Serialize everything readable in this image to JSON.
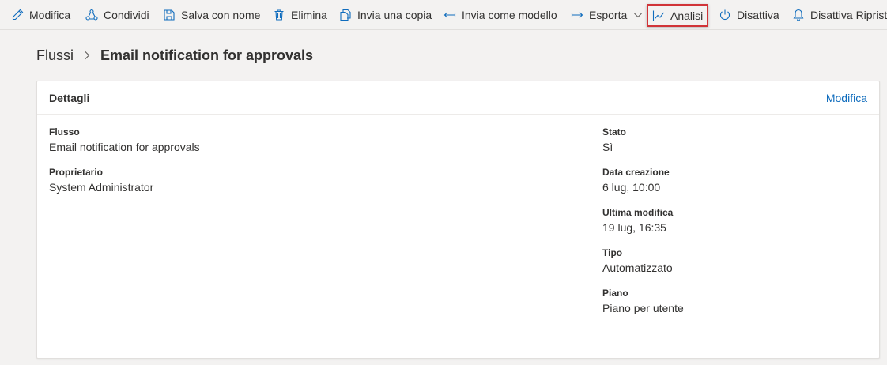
{
  "toolbar": {
    "items": [
      {
        "label": "Modifica",
        "icon": "pencil-icon"
      },
      {
        "label": "Condividi",
        "icon": "share-icon"
      },
      {
        "label": "Salva con nome",
        "icon": "save-as-icon"
      },
      {
        "label": "Elimina",
        "icon": "trash-icon"
      },
      {
        "label": "Invia una copia",
        "icon": "copy-icon"
      },
      {
        "label": "Invia come modello",
        "icon": "arrow-left-icon"
      },
      {
        "label": "Esporta",
        "icon": "arrow-right-icon"
      },
      {
        "label": "Analisi",
        "icon": "chart-icon"
      },
      {
        "label": "Disattiva",
        "icon": "power-icon"
      },
      {
        "label": "Disattiva Ripristi",
        "icon": "bell-icon"
      }
    ]
  },
  "breadcrumb": {
    "root": "Flussi",
    "current": "Email notification for approvals"
  },
  "card": {
    "title": "Dettagli",
    "edit_label": "Modifica",
    "left": [
      {
        "label": "Flusso",
        "value": "Email notification for approvals"
      },
      {
        "label": "Proprietario",
        "value": "System Administrator"
      }
    ],
    "right": [
      {
        "label": "Stato",
        "value": "Sì"
      },
      {
        "label": "Data creazione",
        "value": "6 lug, 10:00"
      },
      {
        "label": "Ultima modifica",
        "value": "19 lug, 16:35"
      },
      {
        "label": "Tipo",
        "value": "Automatizzato"
      },
      {
        "label": "Piano",
        "value": "Piano per utente"
      }
    ]
  },
  "colors": {
    "accent": "#0f6cbd",
    "highlight_border": "#d13438",
    "background": "#f3f2f1"
  }
}
